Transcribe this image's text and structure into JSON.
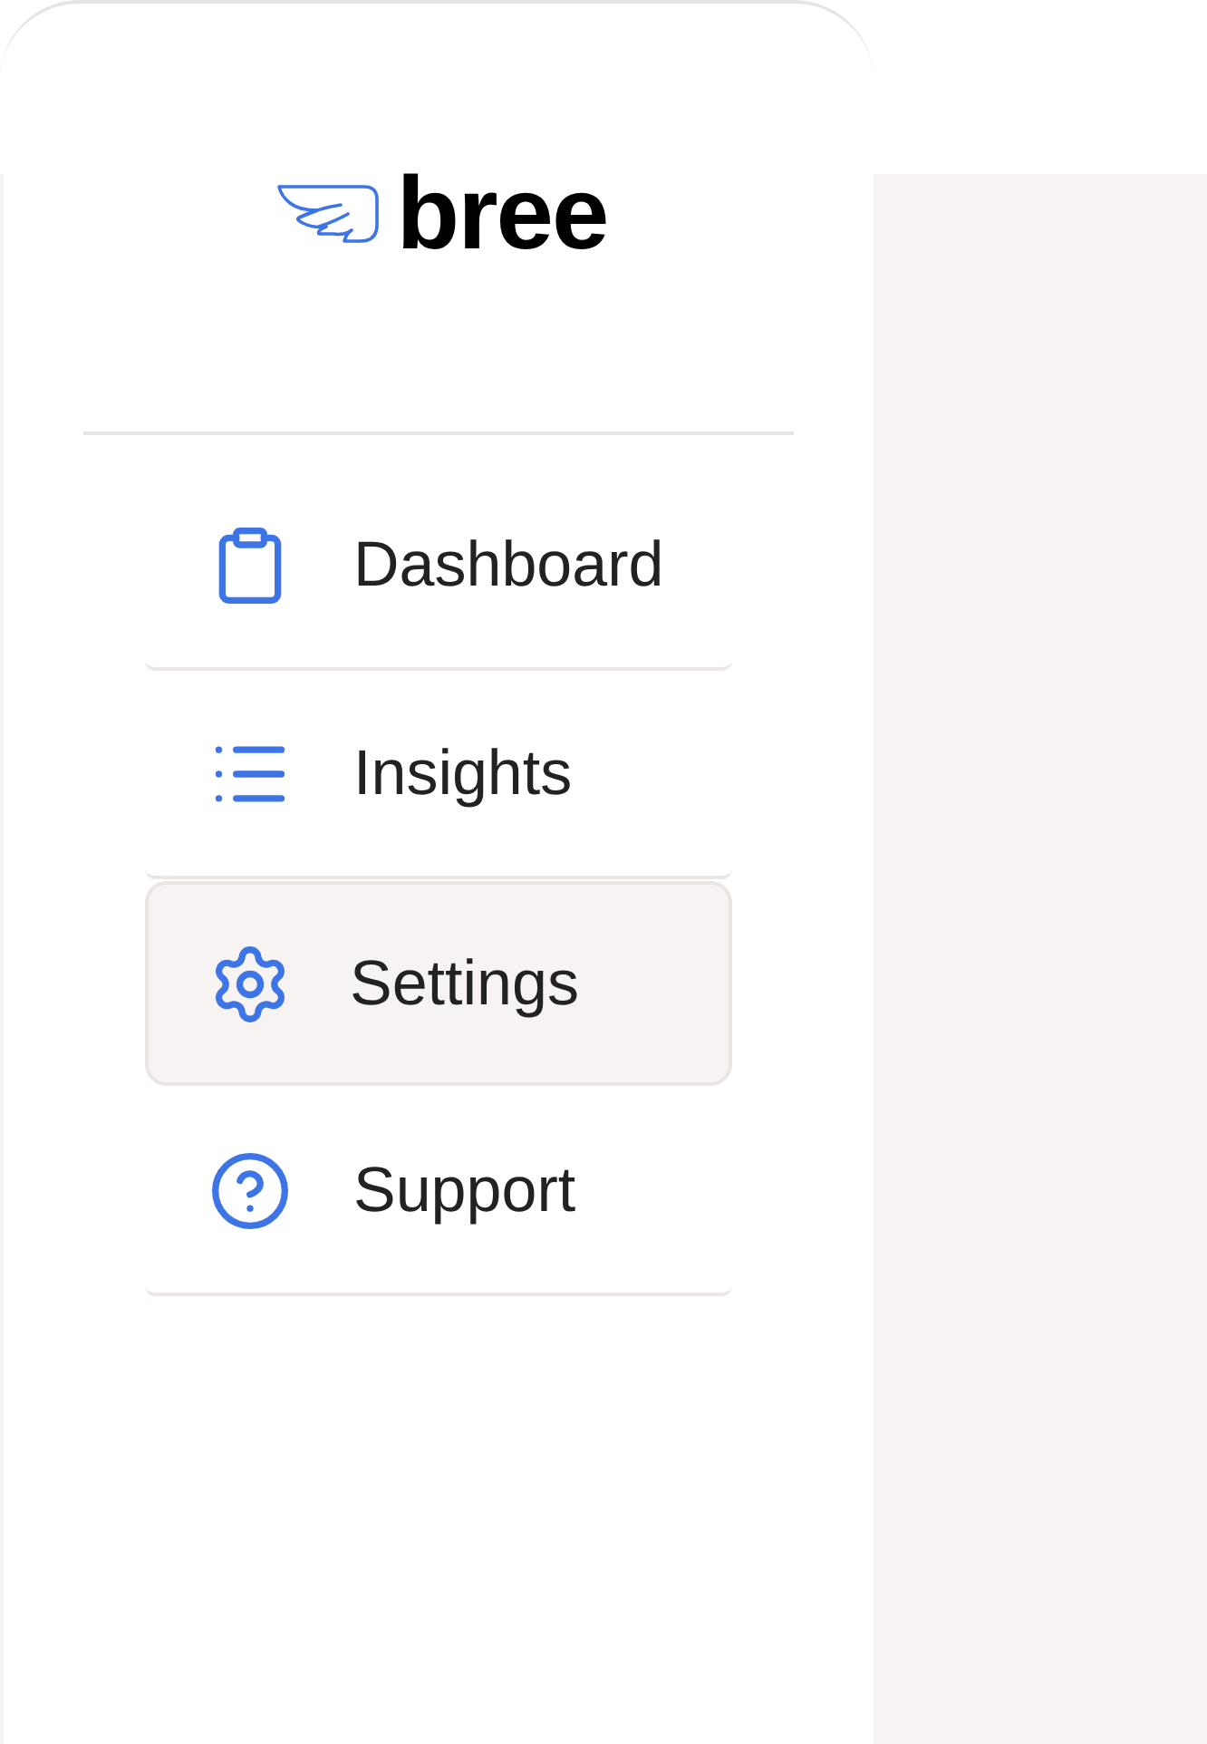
{
  "logo": {
    "text": "bree"
  },
  "nav": {
    "items": [
      {
        "label": "Dashboard",
        "selected": false
      },
      {
        "label": "Insights",
        "selected": false
      },
      {
        "label": "Settings",
        "selected": true
      },
      {
        "label": "Support",
        "selected": false
      }
    ]
  }
}
